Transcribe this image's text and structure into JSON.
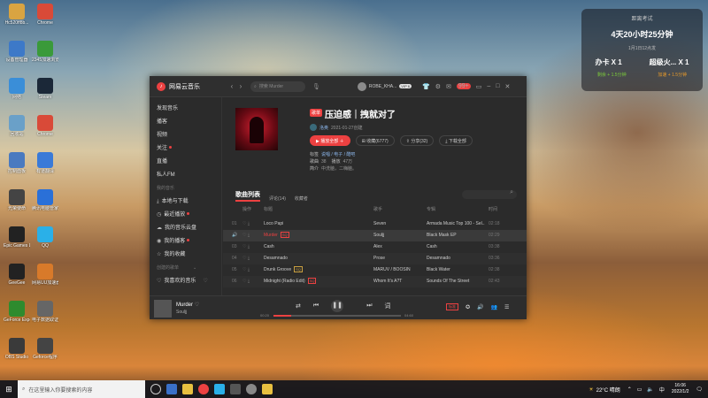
{
  "desktop": {
    "icons": [
      {
        "label": "Hc520ff8b...",
        "color": "#d9a441"
      },
      {
        "label": "设备管理器",
        "color": "#3d79c8"
      },
      {
        "label": "网络",
        "color": "#3a8ed8"
      },
      {
        "label": "回收站",
        "color": "#6aa0c8"
      },
      {
        "label": "控制面板",
        "color": "#4a7ac0"
      },
      {
        "label": "光荣使命",
        "color": "#444444"
      },
      {
        "label": "Epic Games Launcher",
        "color": "#222222"
      },
      {
        "label": "GeeGee",
        "color": "#222222"
      },
      {
        "label": "GeForce Experience",
        "color": "#2e8b2e"
      },
      {
        "label": "OBS Studio",
        "color": "#3a3a3a"
      },
      {
        "label": "Chrome",
        "color": "#d94a38"
      },
      {
        "label": "2345加速浏览器",
        "color": "#3a9a3a"
      },
      {
        "label": "Steam",
        "color": "#1b2838"
      },
      {
        "label": "Chrome",
        "color": "#d94a38"
      },
      {
        "label": "有道翻译",
        "color": "#3a7ad8"
      },
      {
        "label": "腾讯电脑管家",
        "color": "#2a70d8"
      },
      {
        "label": "QQ",
        "color": "#2ab0e8"
      },
      {
        "label": "网易UU加速器",
        "color": "#d87a2a"
      },
      {
        "label": "电子数据取证",
        "color": "#666666"
      },
      {
        "label": "Geforce程序",
        "color": "#444444"
      }
    ]
  },
  "widget": {
    "title": "距离考试",
    "countdown": "4天20小时25分钟",
    "subtitle": "1月1日12点发",
    "left_label": "办卡 X 1",
    "right_label": "超级火... X 1",
    "left_sub": "剩余 + 1.5分钟",
    "right_sub": "加速 + 1.5分钟"
  },
  "app": {
    "logo_icon": "netease-music-icon",
    "title": "网易云音乐",
    "search_placeholder": "搜索 Murder",
    "username": "ROBE_KHA...",
    "vip": "VIP 6",
    "msg_badge": "99+",
    "sidebar": {
      "items": [
        {
          "label": "发现音乐"
        },
        {
          "label": "播客"
        },
        {
          "label": "视频"
        },
        {
          "label": "关注"
        },
        {
          "label": "直播"
        },
        {
          "label": "私人FM"
        }
      ],
      "section_my_music": "我的音乐",
      "my_items": [
        {
          "label": "本地与下载",
          "icon": "download-icon"
        },
        {
          "label": "最近播放",
          "icon": "clock-icon"
        },
        {
          "label": "我的音乐云盘",
          "icon": "cloud-icon"
        },
        {
          "label": "我的播客",
          "icon": "mic-icon"
        },
        {
          "label": "我的收藏",
          "icon": "star-icon"
        }
      ],
      "section_playlists": "创建的歌单",
      "liked": "我喜欢的音乐"
    },
    "playlist": {
      "tag": "歌单",
      "title": "压迫感｜拽就对了",
      "creator": "洛奥",
      "created": "2021-01-27创建",
      "play_all": "播放全部",
      "collect": "收藏(6777)",
      "share": "分享(32)",
      "download": "下载全部",
      "tags_label": "标签",
      "tags": "说唱 / 电子 / 酷吧",
      "songs_label": "歌曲",
      "songs": "38",
      "plays_label": "播放",
      "plays": "47万",
      "intro_label": "简介",
      "intro": "中洗脑，二嗨脑。"
    },
    "tabs": [
      "歌曲列表",
      "评论(14)",
      "收藏者"
    ],
    "columns": {
      "ops": "操作",
      "title": "标题",
      "artist": "歌手",
      "album": "专辑",
      "duration": "时间"
    },
    "tracks": [
      {
        "idx": "01",
        "title": "Loco Papi",
        "tag": "",
        "artist": "Seven",
        "album": "Armada Music Top 100 - Sel...",
        "duration": "02:18"
      },
      {
        "idx": "02",
        "title": "Murder",
        "tag": "SQ",
        "artist": "Souljj",
        "album": "Black Mask EP",
        "duration": "02:29"
      },
      {
        "idx": "03",
        "title": "Cash",
        "tag": "",
        "artist": "Alex",
        "album": "Cash",
        "duration": "03:38"
      },
      {
        "idx": "04",
        "title": "Desamnado",
        "tag": "",
        "artist": "Prose",
        "album": "Desamnado",
        "duration": "03:36"
      },
      {
        "idx": "05",
        "title": "Drunk Groove",
        "tag": "SQ",
        "artist": "MARUV / BOOSIN",
        "album": "Black Water",
        "duration": "02:38"
      },
      {
        "idx": "06",
        "title": "Midnight (Radio Edit)",
        "tag": "SQ",
        "artist": "Whom It's A?T",
        "album": "Sounds Of The Street",
        "duration": "02:43"
      }
    ],
    "player": {
      "title": "Murder",
      "artist": "Souljj",
      "current": "00:20",
      "total": "04:60",
      "progress": 0.14,
      "quality": "标准"
    }
  },
  "taskbar": {
    "search_placeholder": "在这里输入你要搜索的内容",
    "weather": "22°C 晴朗",
    "time": "16:06",
    "date": "2022/1/2",
    "ime": "中"
  }
}
